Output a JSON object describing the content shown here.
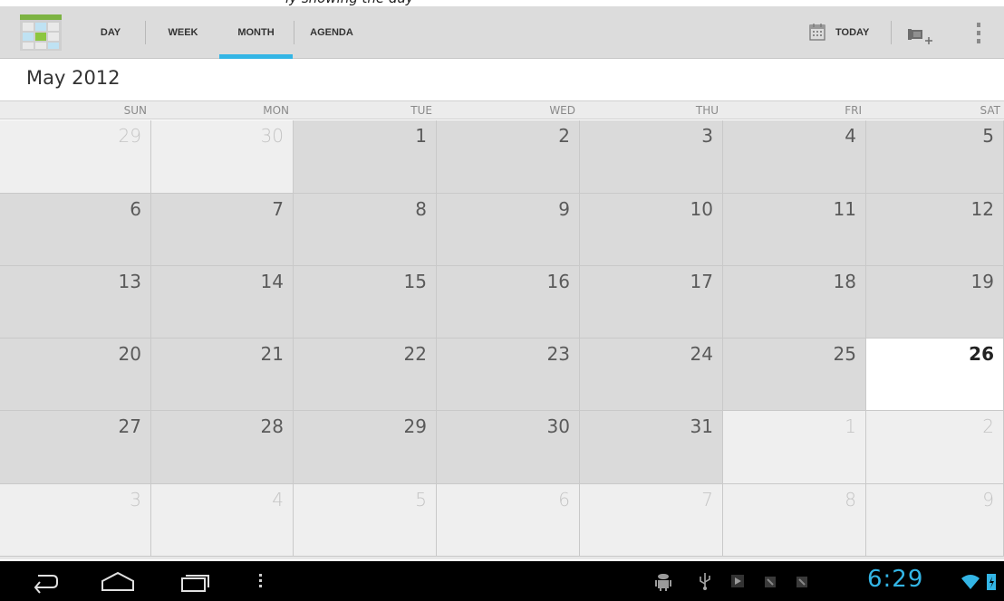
{
  "header": {
    "tabs": [
      {
        "label": "DAY",
        "selected": false
      },
      {
        "label": "WEEK",
        "selected": false
      },
      {
        "label": "MONTH",
        "selected": true
      },
      {
        "label": "AGENDA",
        "selected": false
      }
    ],
    "today_label": "TODAY",
    "accent_color": "#33b5e5"
  },
  "calendar": {
    "month_title": "May 2012",
    "days_of_week": [
      "SUN",
      "MON",
      "TUE",
      "WED",
      "THU",
      "FRI",
      "SAT"
    ],
    "weeks": [
      [
        {
          "d": "29",
          "m": "other"
        },
        {
          "d": "30",
          "m": "other"
        },
        {
          "d": "1",
          "m": "cur"
        },
        {
          "d": "2",
          "m": "cur"
        },
        {
          "d": "3",
          "m": "cur"
        },
        {
          "d": "4",
          "m": "cur"
        },
        {
          "d": "5",
          "m": "cur"
        }
      ],
      [
        {
          "d": "6",
          "m": "cur"
        },
        {
          "d": "7",
          "m": "cur"
        },
        {
          "d": "8",
          "m": "cur"
        },
        {
          "d": "9",
          "m": "cur"
        },
        {
          "d": "10",
          "m": "cur"
        },
        {
          "d": "11",
          "m": "cur"
        },
        {
          "d": "12",
          "m": "cur"
        }
      ],
      [
        {
          "d": "13",
          "m": "cur"
        },
        {
          "d": "14",
          "m": "cur"
        },
        {
          "d": "15",
          "m": "cur"
        },
        {
          "d": "16",
          "m": "cur"
        },
        {
          "d": "17",
          "m": "cur"
        },
        {
          "d": "18",
          "m": "cur"
        },
        {
          "d": "19",
          "m": "cur"
        }
      ],
      [
        {
          "d": "20",
          "m": "cur"
        },
        {
          "d": "21",
          "m": "cur"
        },
        {
          "d": "22",
          "m": "cur"
        },
        {
          "d": "23",
          "m": "cur"
        },
        {
          "d": "24",
          "m": "cur"
        },
        {
          "d": "25",
          "m": "cur"
        },
        {
          "d": "26",
          "m": "today"
        }
      ],
      [
        {
          "d": "27",
          "m": "cur"
        },
        {
          "d": "28",
          "m": "cur"
        },
        {
          "d": "29",
          "m": "cur"
        },
        {
          "d": "30",
          "m": "cur"
        },
        {
          "d": "31",
          "m": "cur"
        },
        {
          "d": "1",
          "m": "other"
        },
        {
          "d": "2",
          "m": "other"
        }
      ],
      [
        {
          "d": "3",
          "m": "other"
        },
        {
          "d": "4",
          "m": "other"
        },
        {
          "d": "5",
          "m": "other"
        },
        {
          "d": "6",
          "m": "other"
        },
        {
          "d": "7",
          "m": "other"
        },
        {
          "d": "8",
          "m": "other"
        },
        {
          "d": "9",
          "m": "other"
        }
      ]
    ]
  },
  "navbar": {
    "buttons": [
      "back-icon",
      "home-icon",
      "recent-apps-icon",
      "menu-icon"
    ],
    "status_icons": [
      "android-debug-icon",
      "usb-icon",
      "play-store-icon",
      "notification-icon",
      "notification-icon",
      "wifi-icon",
      "battery-icon"
    ],
    "clock": "6:29"
  }
}
